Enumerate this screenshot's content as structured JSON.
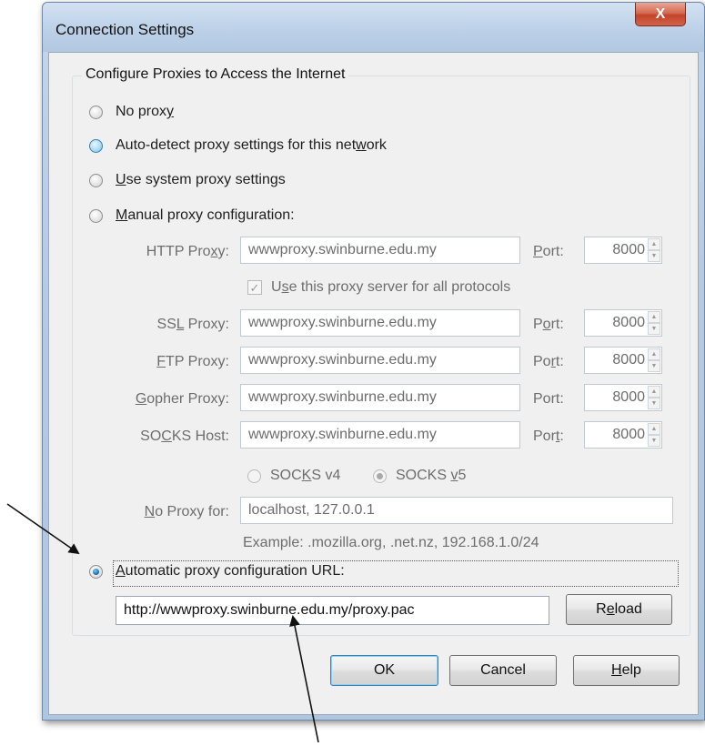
{
  "window": {
    "title": "Connection Settings",
    "close_symbol": "X"
  },
  "group": {
    "label": "Configure Proxies to Access the Internet"
  },
  "options": {
    "no_proxy": {
      "pre": "No prox",
      "acc": "y",
      "post": "",
      "selected": false
    },
    "auto_detect": {
      "pre": "Auto-detect proxy settings for this net",
      "acc": "w",
      "post": "ork",
      "selected": false
    },
    "system": {
      "pre": "",
      "acc": "U",
      "post": "se system proxy settings",
      "selected": false
    },
    "manual": {
      "pre": "",
      "acc": "M",
      "post": "anual proxy configuration:",
      "selected": false
    },
    "auto_url": {
      "pre": "",
      "acc": "A",
      "post": "utomatic proxy configuration URL:",
      "selected": true
    }
  },
  "manual": {
    "http": {
      "label_pre": "HTTP Pro",
      "label_acc": "x",
      "label_post": "y:",
      "value": "wwwproxy.swinburne.edu.my",
      "port_pre": "",
      "port_acc": "P",
      "port_post": "ort:",
      "port": "8000"
    },
    "all_protocols": {
      "pre": "U",
      "acc": "s",
      "post": "e this proxy server for all protocols",
      "checked": true
    },
    "ssl": {
      "label_pre": "SS",
      "label_acc": "L",
      "label_post": " Proxy:",
      "value": "wwwproxy.swinburne.edu.my",
      "port_pre": "P",
      "port_acc": "o",
      "port_post": "rt:",
      "port": "8000"
    },
    "ftp": {
      "label_pre": "",
      "label_acc": "F",
      "label_post": "TP Proxy:",
      "value": "wwwproxy.swinburne.edu.my",
      "port_pre": "Po",
      "port_acc": "r",
      "port_post": "t:",
      "port": "8000"
    },
    "gopher": {
      "label_pre": "",
      "label_acc": "G",
      "label_post": "opher Proxy:",
      "value": "wwwproxy.swinburne.edu.my",
      "port_pre": "Port:",
      "port_acc": "",
      "port_post": "",
      "port": "8000"
    },
    "socks": {
      "label_pre": "SO",
      "label_acc": "C",
      "label_post": "KS Host:",
      "value": "wwwproxy.swinburne.edu.my",
      "port_pre": "Por",
      "port_acc": "t",
      "port_post": ":",
      "port": "8000"
    },
    "socks_v4": {
      "pre": "SOC",
      "acc": "K",
      "post": "S v4",
      "selected": false
    },
    "socks_v5": {
      "pre": "SOCKS ",
      "acc": "v",
      "post": "5",
      "selected": true
    },
    "no_proxy_for": {
      "label_pre": "",
      "label_acc": "N",
      "label_post": "o Proxy for:",
      "value": "localhost, 127.0.0.1"
    },
    "example": "Example: .mozilla.org, .net.nz, 192.168.1.0/24",
    "spin_up": "▲",
    "spin_down": "▼",
    "check_mark": "✓"
  },
  "pac": {
    "url": "http://wwwproxy.swinburne.edu.my/proxy.pac",
    "reload_pre": "R",
    "reload_acc": "e",
    "reload_post": "load"
  },
  "buttons": {
    "ok": "OK",
    "cancel": "Cancel",
    "help_acc": "H",
    "help_post": "elp"
  }
}
